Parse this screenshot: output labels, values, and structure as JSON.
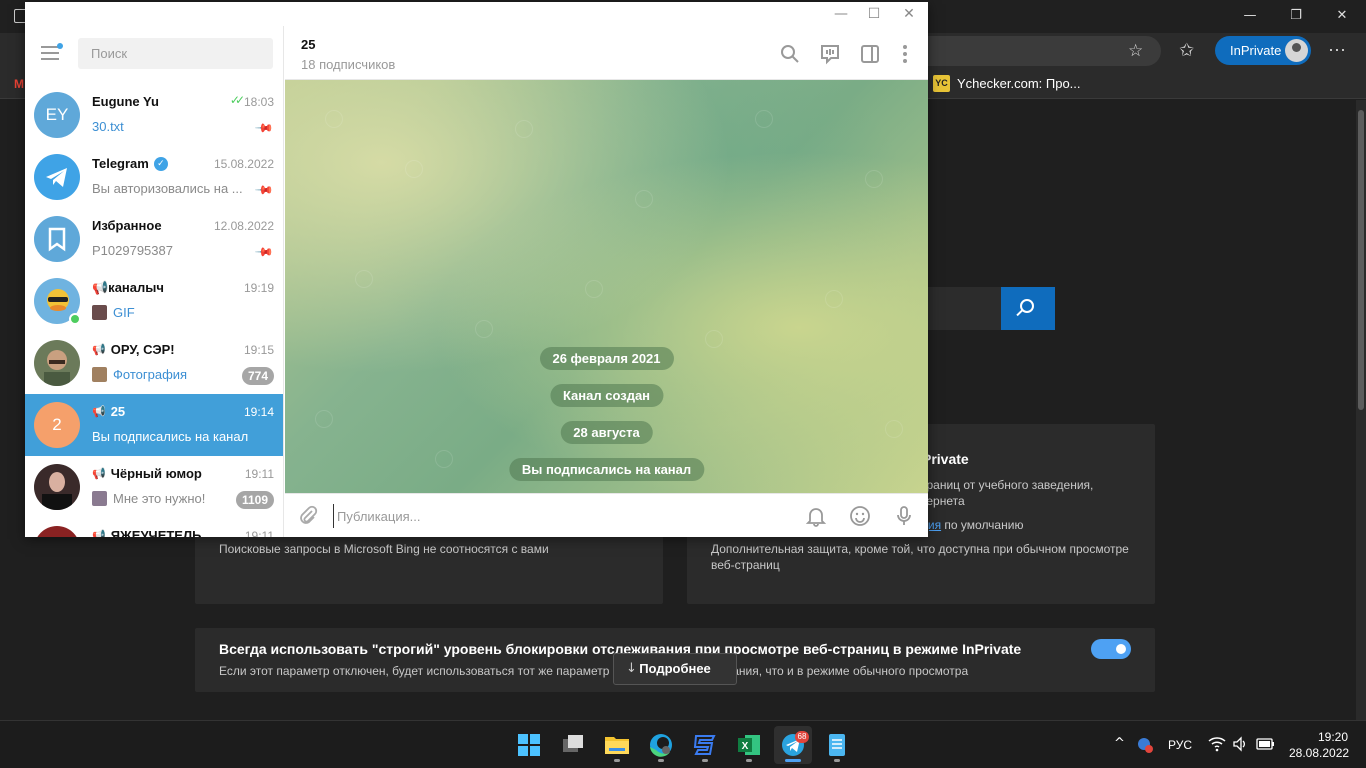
{
  "edge": {
    "window_controls": {
      "minimize": "—",
      "maximize": "❐",
      "close": "✕"
    },
    "inprivate_label": "InPrivate",
    "more": "···",
    "bookmarks": [
      {
        "label": "M",
        "icon": "gmail-icon"
      },
      {
        "label": "Ychecker.com: Про...",
        "icon_text": "YC"
      }
    ],
    "page": {
      "card_right_title": "Private",
      "card_right_line1": "траниц от учебного заведения,",
      "card_right_line2": "тернета",
      "card_right_link": "ция",
      "card_right_line3_rest": " по умолчанию",
      "card_left_text": "Поисковые запросы в Microsoft Bing не соотносятся с вами",
      "card_right_text1": "Дополнительная защита, кроме той, что доступна при обычном просмотре",
      "card_right_text2": "веб-страниц",
      "strict_title": "Всегда использовать \"строгий\" уровень блокировки отслеживания при просмотре веб-страниц в режиме InPrivate",
      "strict_desc": "Если этот параметр отключен, будет использоваться тот же параметр блокировки отслеживания, что и в режиме обычного просмотра",
      "strict_toggle_on": true,
      "more_button": "Подробнее"
    }
  },
  "telegram": {
    "window_controls": {
      "minimize": "—",
      "maximize": "☐",
      "close": "✕"
    },
    "search_placeholder": "Поиск",
    "chats": [
      {
        "name": "Eugune Yu",
        "time": "18:03",
        "preview": "30.txt",
        "avatar_text": "EY",
        "avatar_color": "#5fa8d9",
        "pinned": true,
        "read": true,
        "preview_highlight": true
      },
      {
        "name": "Telegram",
        "time": "15.08.2022",
        "preview": "Вы авторизовались на ...",
        "avatar_color": "#3fa3e6",
        "pinned": true,
        "verified": true
      },
      {
        "name": "Избранное",
        "time": "12.08.2022",
        "preview": "P1029795387",
        "avatar_color": "#5fa8d9",
        "pinned": true
      },
      {
        "name": "📢каналыч",
        "time": "19:19",
        "preview": "GIF",
        "avatar_color": "#6fb3e0",
        "online": true,
        "preview_highlight": true
      },
      {
        "name": "ОРУ, СЭР!",
        "time": "19:15",
        "preview": "Фотография",
        "avatar_color": "#6b7a5a",
        "badge": "774",
        "channel": true,
        "preview_highlight": true
      },
      {
        "name": "25",
        "time": "19:14",
        "preview": "Вы подписались на канал",
        "avatar_text": "2",
        "avatar_color": "#f5a06b",
        "channel": true,
        "active": true
      },
      {
        "name": "Чёрный юмор",
        "time": "19:11",
        "preview": "Мне это нужно!",
        "avatar_color": "#3a2a2a",
        "badge": "1109",
        "channel": true
      },
      {
        "name": "ЯЖЕУЧЕТЕЛЬ",
        "time": "19:11",
        "preview": "",
        "avatar_color": "#8a2222",
        "channel": true
      }
    ],
    "current_chat": {
      "title": "25",
      "subtitle": "18 подписчиков"
    },
    "messages": [
      {
        "text": "26 февраля 2021"
      },
      {
        "text": "Канал создан"
      },
      {
        "text": "28 августа"
      },
      {
        "text": "Вы подписались на канал"
      }
    ],
    "input_placeholder": "Публикация..."
  },
  "taskbar": {
    "apps": [
      {
        "name": "start",
        "icon": "windows-icon"
      },
      {
        "name": "task-view",
        "icon": "taskview-icon"
      },
      {
        "name": "explorer",
        "icon": "folder-icon"
      },
      {
        "name": "edge",
        "icon": "edge-icon"
      },
      {
        "name": "app-s",
        "icon": "s-app-icon"
      },
      {
        "name": "excel",
        "icon": "excel-icon"
      },
      {
        "name": "telegram",
        "icon": "telegram-icon",
        "badge": "68",
        "active": true
      },
      {
        "name": "notepad",
        "icon": "notepad-icon"
      }
    ],
    "lang": "РУС",
    "time": "19:20",
    "date": "28.08.2022"
  }
}
